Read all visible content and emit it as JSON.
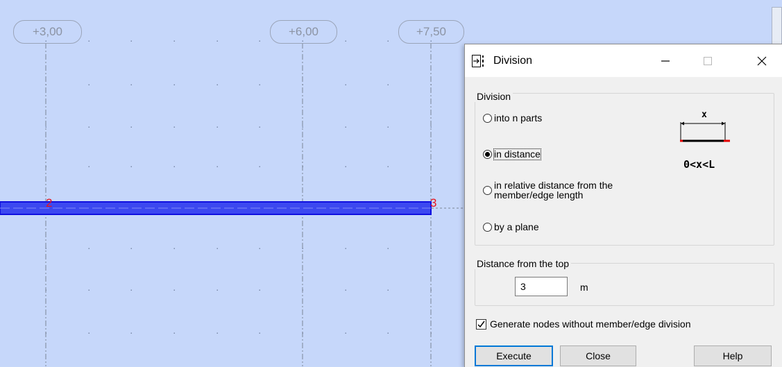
{
  "canvas": {
    "axis_labels": [
      "+3,00",
      "+6,00",
      "+7,50"
    ],
    "node_labels": [
      "2",
      "3"
    ],
    "colors": {
      "background": "#c6d7fa",
      "member": "#1010e0",
      "node_label": "#e8141c",
      "axis_line": "#7b8497"
    }
  },
  "dialog": {
    "title": "Division",
    "title_icon": "division-arrow-icon",
    "window_controls": {
      "minimize_icon": "minimize-icon",
      "maximize_icon": "maximize-icon",
      "close_icon": "close-icon"
    },
    "division_group": {
      "label": "Division",
      "options": [
        {
          "label": "into n parts",
          "checked": false
        },
        {
          "label": "in distance",
          "checked": true
        },
        {
          "label_line1": "in relative distance from the",
          "label_line2": "member/edge length",
          "checked": false
        },
        {
          "label": "by a plane",
          "checked": false
        }
      ],
      "diagram": {
        "x_label": "x",
        "formula": "0<x<L"
      }
    },
    "distance_group": {
      "label": "Distance from the top",
      "value": "3",
      "unit": "m"
    },
    "generate_nodes": {
      "label": "Generate nodes without member/edge division",
      "checked": true
    },
    "buttons": {
      "execute": "Execute",
      "close": "Close",
      "help": "Help"
    }
  }
}
